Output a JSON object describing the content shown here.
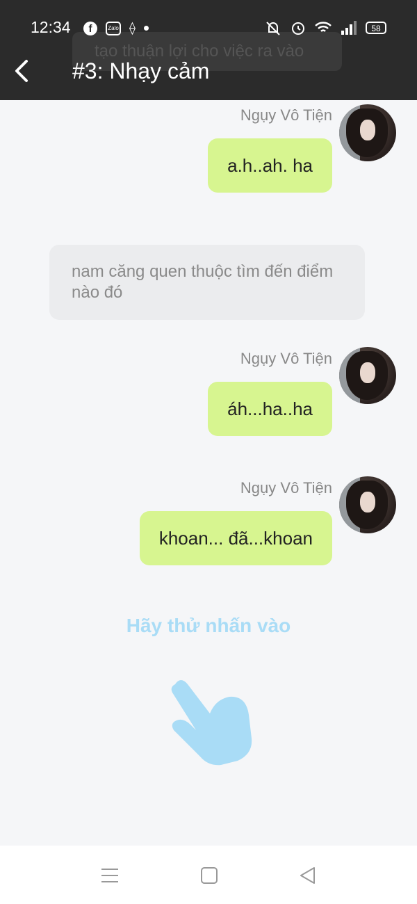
{
  "status_bar": {
    "time": "12:34",
    "battery": "58"
  },
  "header": {
    "title": "#3: Nhạy cảm",
    "background_text": "tạo thuận lợi cho việc ra vào"
  },
  "messages": [
    {
      "type": "outgoing",
      "sender": "Ngụy Vô Tiện",
      "text": "a.h..ah. ha"
    },
    {
      "type": "narration",
      "text": "nam căng quen thuộc tìm đến điểm nào đó"
    },
    {
      "type": "outgoing",
      "sender": "Ngụy Vô Tiện",
      "text": "áh...ha..ha"
    },
    {
      "type": "outgoing",
      "sender": "Ngụy Vô Tiện",
      "text": "khoan... đã...khoan"
    }
  ],
  "hint": {
    "text": "Hãy thử nhấn vào"
  },
  "icons": {
    "back": "chevron-left-icon",
    "hand": "pointing-hand-icon",
    "nav_menu": "menu-icon",
    "nav_home": "square-icon",
    "nav_back": "triangle-back-icon"
  },
  "colors": {
    "header_bg": "#2b2b2b",
    "bubble_out": "#d7f590",
    "narration_bg": "#ebecee",
    "hint": "#a9dcf6"
  }
}
